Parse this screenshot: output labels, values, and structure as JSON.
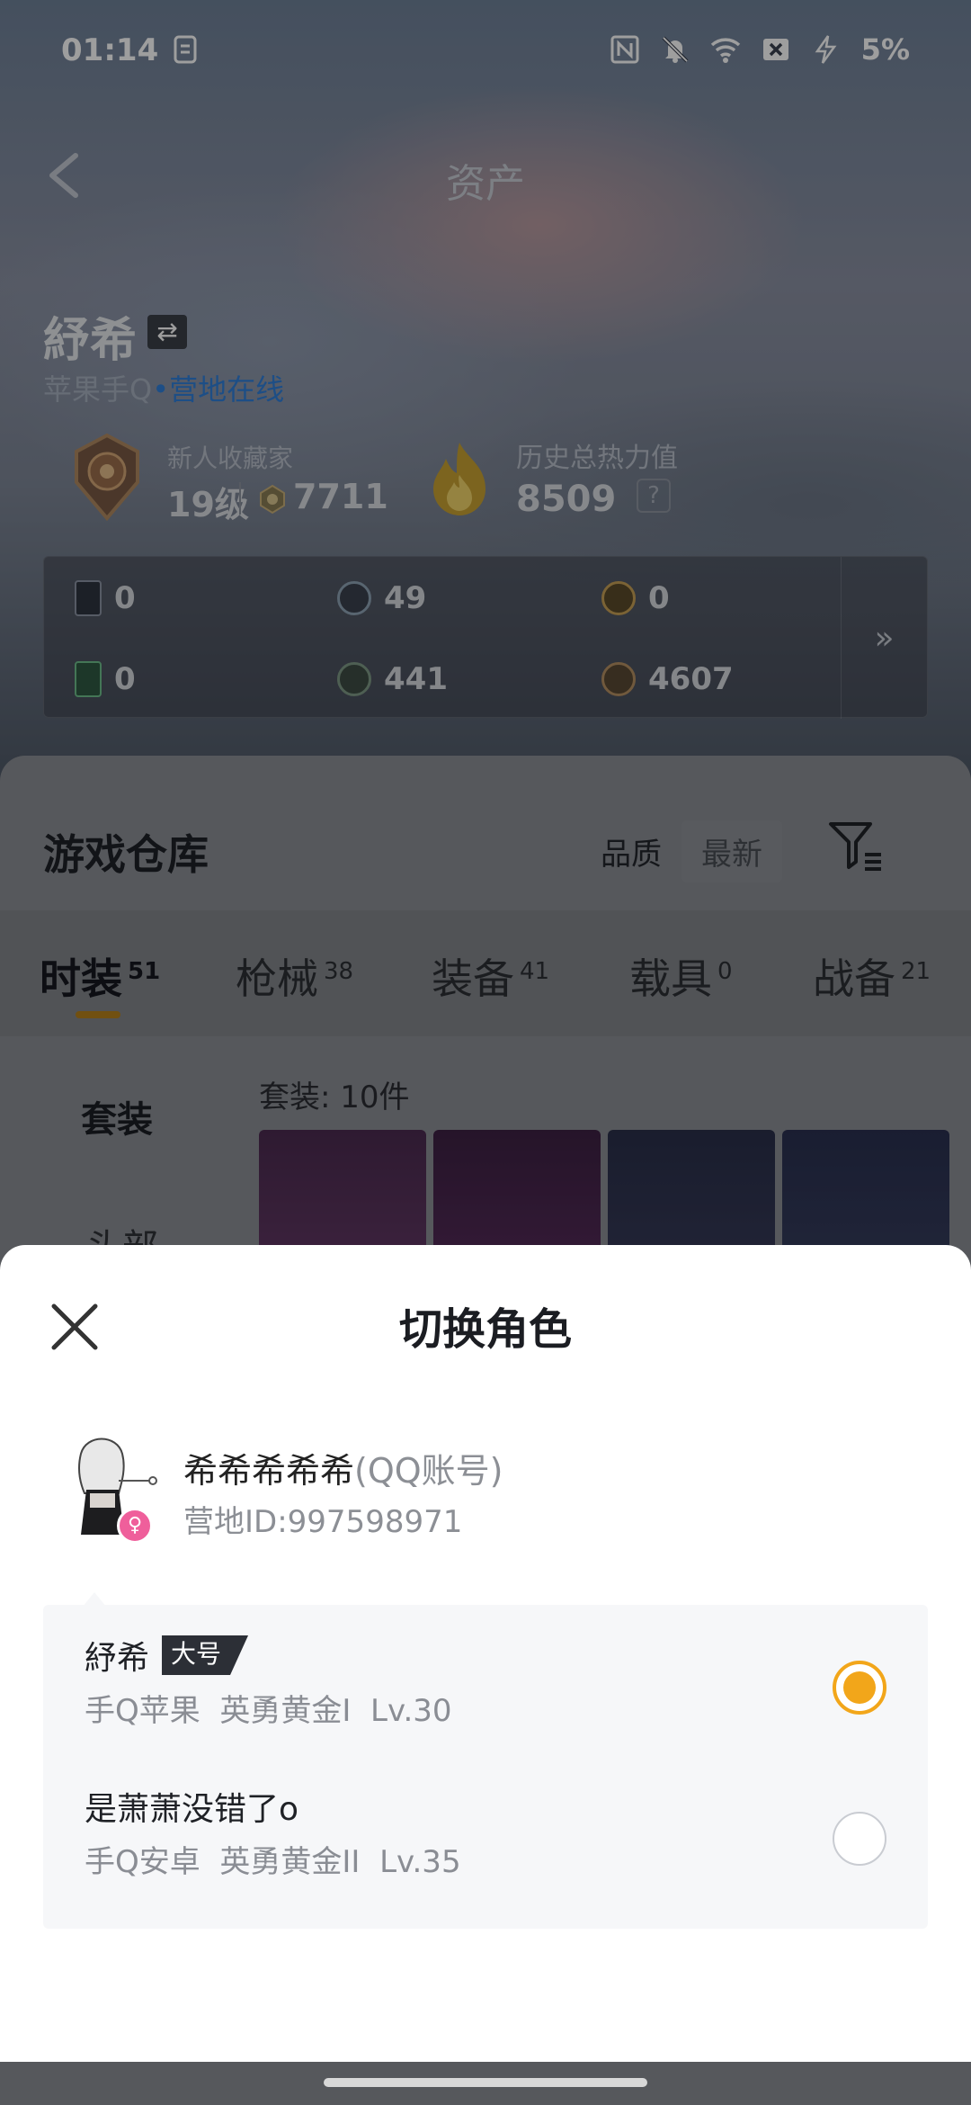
{
  "status_bar": {
    "time": "01:14",
    "battery": "5%",
    "icons": [
      "clipboard-icon",
      "nfc-icon",
      "bell-off-icon",
      "wifi-icon",
      "sim-off-icon",
      "charging-icon"
    ]
  },
  "nav": {
    "title": "资产"
  },
  "profile": {
    "name": "紓希",
    "platform": "苹果手Q",
    "online_status": "营地在线",
    "collector_title": "新人收藏家",
    "collector_level": "19级",
    "collector_coins": "7711",
    "heat_title": "历史总热力值",
    "heat_value": "8509",
    "heat_help": "?"
  },
  "currencies": [
    {
      "icon": "card-dark-icon",
      "value": "0"
    },
    {
      "icon": "coin-s-icon",
      "value": "49"
    },
    {
      "icon": "coin-gold-icon",
      "value": "0"
    },
    {
      "icon": "card-green-icon",
      "value": "0"
    },
    {
      "icon": "coin-green-icon",
      "value": "441"
    },
    {
      "icon": "coin-bronze-icon",
      "value": "4607"
    }
  ],
  "currency_more": "»",
  "warehouse": {
    "title": "游戏仓库",
    "sort_options": [
      "品质",
      "最新"
    ],
    "tabs": [
      {
        "label": "时装",
        "count": "51"
      },
      {
        "label": "枪械",
        "count": "38"
      },
      {
        "label": "装备",
        "count": "41"
      },
      {
        "label": "载具",
        "count": "0"
      },
      {
        "label": "战备",
        "count": "21"
      }
    ],
    "side_categories": [
      "套装",
      "头部"
    ],
    "set_count": "套装: 10件"
  },
  "sheet": {
    "title": "切换角色",
    "account": {
      "name": "希希希希希",
      "type": "(QQ账号)",
      "id": "营地ID:997598971"
    },
    "roles": [
      {
        "name": "紓希",
        "tag": "大号",
        "platform": "手Q苹果",
        "rank": "英勇黄金I",
        "level": "Lv.30",
        "selected": true
      },
      {
        "name": "是萧萧没错了o",
        "tag": "",
        "platform": "手Q安卓",
        "rank": "英勇黄金II",
        "level": "Lv.35",
        "selected": false
      }
    ]
  },
  "colors": {
    "accent": "#f2a61a",
    "online": "#2f7fd8",
    "gender": "#ef5f9b"
  }
}
